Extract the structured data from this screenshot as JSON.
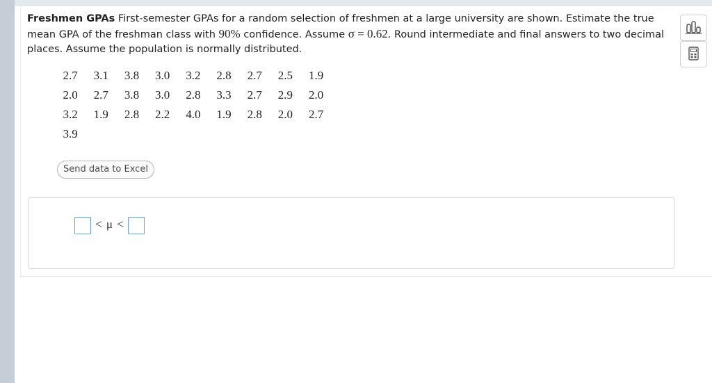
{
  "question": {
    "title": "Freshmen GPAs",
    "text_part1": " First-semester GPAs for a random selection of freshmen at a large university are shown. Estimate the true mean GPA of the freshman class with ",
    "confidence": "90%",
    "text_part2": " confidence. Assume ",
    "sigma_expr": "σ = 0.62",
    "text_part3": ". Round intermediate and final answers to two decimal places. Assume the population is normally distributed."
  },
  "data_rows": [
    [
      "2.7",
      "3.1",
      "3.8",
      "3.0",
      "3.2",
      "2.8",
      "2.7",
      "2.5",
      "1.9"
    ],
    [
      "2.0",
      "2.7",
      "3.8",
      "3.0",
      "2.8",
      "3.3",
      "2.7",
      "2.9",
      "2.0"
    ],
    [
      "3.2",
      "1.9",
      "2.8",
      "2.2",
      "4.0",
      "1.9",
      "2.8",
      "2.0",
      "2.7"
    ],
    [
      "3.9"
    ]
  ],
  "excel_button_label": "Send data to Excel",
  "answer": {
    "symbol": "< μ <",
    "lower_value": "",
    "upper_value": ""
  },
  "tools": [
    {
      "icon": "bar-chart-icon"
    },
    {
      "icon": "calculator-icon"
    }
  ],
  "colors": {
    "left_rail": "#c5ced6",
    "input_border": "#6f9fd0"
  }
}
